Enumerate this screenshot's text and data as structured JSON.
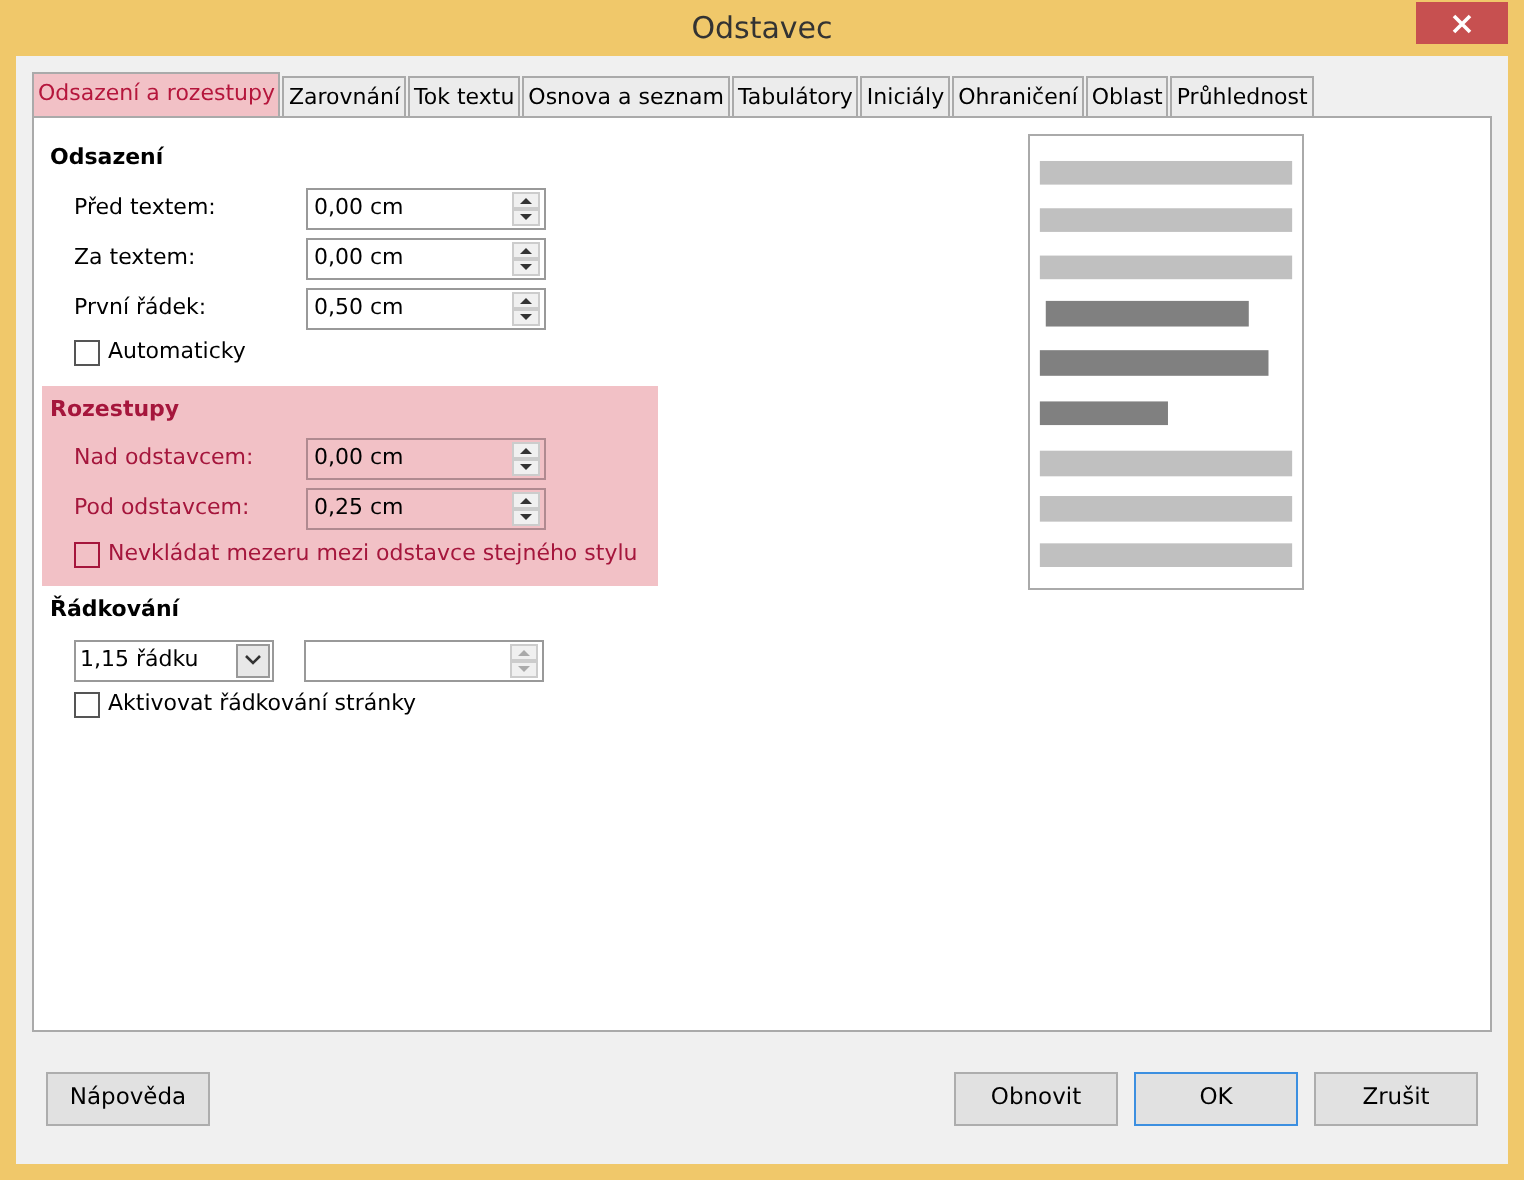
{
  "window": {
    "title": "Odstavec"
  },
  "tabs": [
    {
      "label": "Odsazení a rozestupy",
      "selected": true
    },
    {
      "label": "Zarovnání",
      "selected": false
    },
    {
      "label": "Tok textu",
      "selected": false
    },
    {
      "label": "Osnova a seznam",
      "selected": false
    },
    {
      "label": "Tabulátory",
      "selected": false
    },
    {
      "label": "Iniciály",
      "selected": false
    },
    {
      "label": "Ohraničení",
      "selected": false
    },
    {
      "label": "Oblast",
      "selected": false
    },
    {
      "label": "Průhlednost",
      "selected": false
    }
  ],
  "sections": [
    {
      "title": "Odsazení",
      "highlighted": false,
      "rows": [
        {
          "kind": "spin",
          "label": "Před textem:",
          "value": "0,00 cm"
        },
        {
          "kind": "spin",
          "label": "Za textem:",
          "value": "0,00 cm"
        },
        {
          "kind": "spin",
          "label": "První řádek:",
          "value": "0,50 cm"
        },
        {
          "kind": "checkbox",
          "label": "Automaticky",
          "checked": false
        }
      ]
    },
    {
      "title": "Rozestupy",
      "highlighted": true,
      "rows": [
        {
          "kind": "spin",
          "label": "Nad odstavcem:",
          "value": "0,00 cm"
        },
        {
          "kind": "spin",
          "label": "Pod odstavcem:",
          "value": "0,25 cm"
        },
        {
          "kind": "checkbox",
          "label": "Nevkládat mezeru mezi odstavce stejného stylu",
          "checked": false
        }
      ]
    },
    {
      "title": "Řádkování",
      "highlighted": false,
      "rows": [
        {
          "kind": "combo",
          "value": "1,15 řádku"
        },
        {
          "kind": "checkbox",
          "label": "Aktivovat řádkování stránky",
          "checked": false
        }
      ]
    }
  ],
  "buttons": [
    {
      "label": "Nápověda",
      "kind": "help",
      "default": false
    },
    {
      "label": "Obnovit",
      "kind": "action",
      "default": false
    },
    {
      "label": "OK",
      "kind": "action",
      "default": true
    },
    {
      "label": "Zrušit",
      "kind": "action",
      "default": false
    }
  ]
}
